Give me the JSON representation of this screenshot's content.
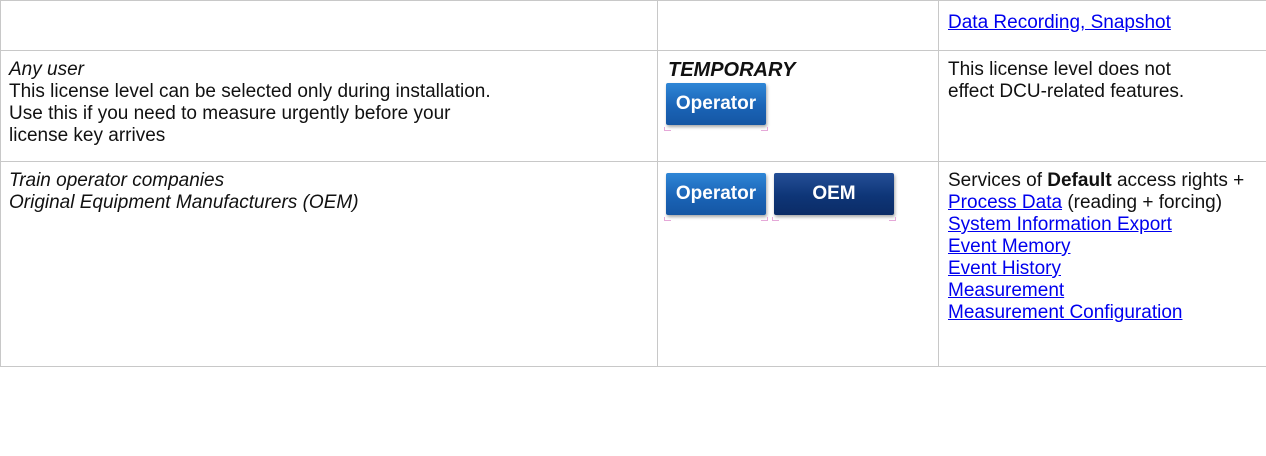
{
  "rows": [
    {
      "features": {
        "links": [
          "Data Recording, Snapshot"
        ]
      }
    },
    {
      "users": {
        "title": "Any user",
        "description": [
          "This license level can be selected only during installation.",
          "Use this if you need to measure urgently before your",
          "license key arrives"
        ]
      },
      "license": {
        "caption": "TEMPORARY",
        "buttons": [
          "Operator"
        ]
      },
      "features": {
        "text": [
          "This license level does not",
          "effect DCU-related features."
        ]
      }
    },
    {
      "users": {
        "lines": [
          "Train operator companies",
          "Original Equipment Manufacturers (OEM)"
        ]
      },
      "license": {
        "buttons": [
          "Operator",
          "OEM"
        ]
      },
      "features": {
        "intro_prefix": "Services of ",
        "intro_bold": "Default",
        "intro_suffix": " access rights +",
        "process_link": "Process Data",
        "process_suffix": " (reading + forcing)",
        "links": [
          "System Information Export",
          "Event Memory",
          "Event History",
          "Measurement",
          "Measurement Configuration"
        ]
      }
    }
  ],
  "colors": {
    "link": "#0000ee",
    "operator_button": "#1a64b7",
    "oem_button": "#0e3577",
    "border": "#c8c8c8"
  }
}
